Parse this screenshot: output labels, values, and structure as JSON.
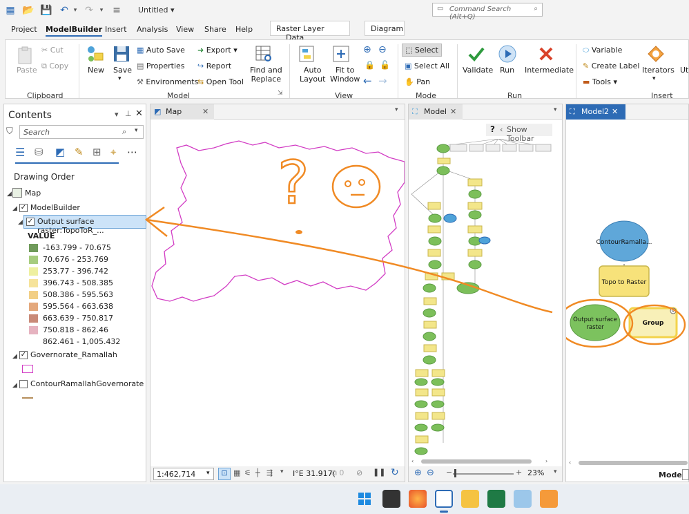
{
  "window": {
    "title": "Untitled"
  },
  "command_search": {
    "placeholder": "Command Search (Alt+Q)"
  },
  "menu_tabs": [
    "Project",
    "ModelBuilder",
    "Insert",
    "Analysis",
    "View",
    "Share",
    "Help"
  ],
  "context_tabs": [
    "Raster Layer",
    "Data",
    "Diagram"
  ],
  "ribbon": {
    "clipboard": {
      "paste": "Paste",
      "cut": "Cut",
      "copy": "Copy",
      "label": "Clipboard"
    },
    "model": {
      "new": "New",
      "save": "Save",
      "auto_save": "Auto Save",
      "properties": "Properties",
      "environments": "Environments",
      "export": "Export",
      "report": "Report",
      "open_tool": "Open Tool",
      "find_replace_1": "Find and",
      "find_replace_2": "Replace",
      "label": "Model"
    },
    "view": {
      "auto_layout_1": "Auto",
      "auto_layout_2": "Layout",
      "fit_1": "Fit to",
      "fit_2": "Window",
      "label": "View"
    },
    "mode": {
      "select": "Select",
      "select_all": "Select All",
      "pan": "Pan",
      "label": "Mode"
    },
    "run": {
      "validate": "Validate",
      "run": "Run",
      "intermediate": "Intermediate",
      "label": "Run"
    },
    "insert": {
      "variable": "Variable",
      "create_label": "Create Label",
      "tools": "Tools",
      "iterators": "Iterators",
      "utilities": "Uti",
      "label": "Insert"
    }
  },
  "contents": {
    "title": "Contents",
    "search_placeholder": "Search",
    "drawing_order": "Drawing Order",
    "map": "Map",
    "group_layer": "ModelBuilder",
    "raster_layer": "Output surface raster:TopoToR_...",
    "value_header": "VALUE",
    "legend": [
      {
        "label": "-163.799 - 70.675",
        "color": "#6f9a5a"
      },
      {
        "label": "70.676 - 253.769",
        "color": "#a6cc7e"
      },
      {
        "label": "253.77 - 396.742",
        "color": "#eef0a0"
      },
      {
        "label": "396.743 - 508.385",
        "color": "#f6e39a"
      },
      {
        "label": "508.386 - 595.563",
        "color": "#f2cf86"
      },
      {
        "label": "595.564 - 663.638",
        "color": "#e4a87c"
      },
      {
        "label": "663.639 - 750.817",
        "color": "#c98a78"
      },
      {
        "label": "750.818 - 862.46",
        "color": "#e6b3c0"
      },
      {
        "label": "862.461 - 1,005.432",
        "color": "#ffffff"
      }
    ],
    "layer2": "Governorate_Ramallah",
    "layer3": "ContourRamallahGovernorate"
  },
  "map_view": {
    "tab": "Map",
    "scale": "1:462,714",
    "coords": "I°E 31.917("
  },
  "model_view": {
    "tab": "Model",
    "show_toolbar": "Show Toolbar",
    "zoom": "23%"
  },
  "model2_view": {
    "tab": "Model2",
    "nodes": {
      "input": "ContourRamalla...",
      "tool": "Topo to Raster",
      "output_1": "Output surface",
      "output_2": "raster",
      "group": "Group"
    },
    "mode_label": "Mode:"
  },
  "annotation": {
    "question": "?"
  }
}
